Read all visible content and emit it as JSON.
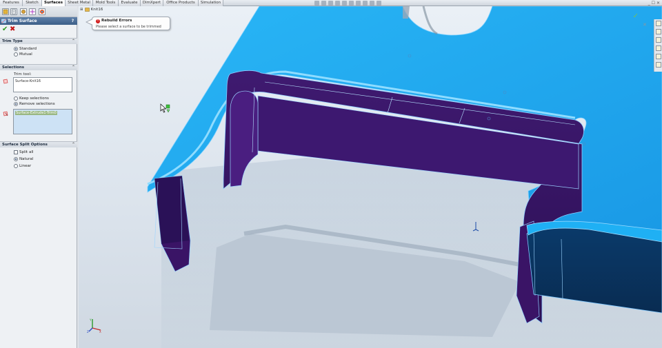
{
  "command_manager": {
    "tabs": [
      "Features",
      "Sketch",
      "Surfaces",
      "Sheet Metal",
      "Mold Tools",
      "Evaluate",
      "DimXpert",
      "Office Products",
      "Simulation"
    ],
    "active_tab": "Surfaces"
  },
  "window_controls": "_ ☐ ✕",
  "property_manager": {
    "title": "Trim Surface",
    "help": "?",
    "ok": "✔",
    "cancel": "✖",
    "trim_type": {
      "header": "Trim Type",
      "options": [
        "Standard",
        "Mutual"
      ],
      "selected": "Standard"
    },
    "selections": {
      "header": "Selections",
      "trim_tool_label": "Trim tool:",
      "trim_tool_value": "Surface-Knit16",
      "keep_label": "Keep selections",
      "remove_label": "Remove selections",
      "selected_option": "Remove selections",
      "pieces_value": "Surface-Extrude1-Trim0"
    },
    "split_options": {
      "header": "Surface Split Options",
      "split_all": "Split all",
      "natural": "Natural",
      "linear": "Linear",
      "selected": "Natural"
    }
  },
  "feature_tree_flyout": "Knit16",
  "tooltip": {
    "title": "Rebuild Errors",
    "message": "Please select a surface to be trimmed"
  },
  "colors": {
    "surface_light": "#1ea9ef",
    "surface_dark": "#3a1568",
    "edge": "#9fd8ff"
  }
}
